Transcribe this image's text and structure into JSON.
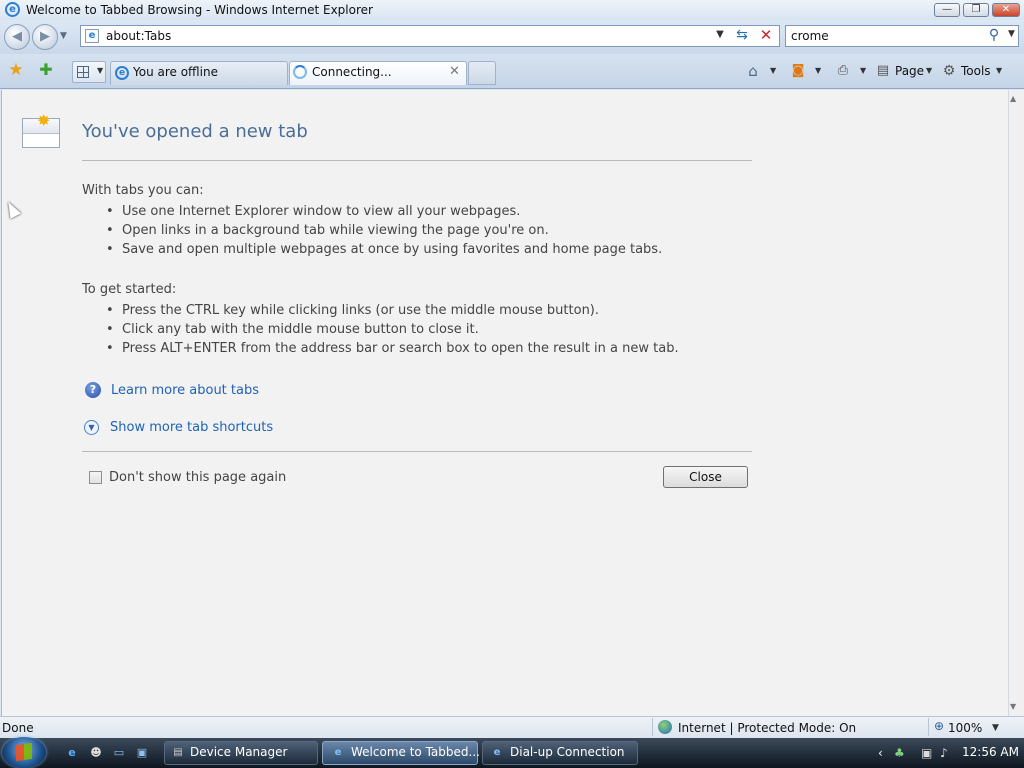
{
  "window": {
    "title": "Welcome to Tabbed Browsing - Windows Internet Explorer",
    "controls": {
      "minimize": "—",
      "maximize": "❐",
      "close": "✕"
    }
  },
  "address_bar": {
    "url": "about:Tabs",
    "back_icon": "back-arrow",
    "forward_icon": "forward-arrow"
  },
  "search": {
    "value": "crome"
  },
  "tabs": [
    {
      "label": "You are offline",
      "state": "inactive"
    },
    {
      "label": "Connecting...",
      "state": "active"
    }
  ],
  "command_bar": {
    "page_label": "Page",
    "tools_label": "Tools"
  },
  "content": {
    "heading": "You've opened a new tab",
    "section1_title": "With tabs you can:",
    "section1_items": [
      "Use one Internet Explorer window to view all your webpages.",
      "Open links in a background tab while viewing the page you're on.",
      "Save and open multiple webpages at once by using favorites and home page tabs."
    ],
    "section2_title": "To get started:",
    "section2_items": [
      "Press the CTRL key while clicking links (or use the middle mouse button).",
      "Click any tab with the middle mouse button to close it.",
      "Press ALT+ENTER from the address bar or search box to open the result in a new tab."
    ],
    "learn_more_link": "Learn more about tabs",
    "shortcuts_link": "Show more tab shortcuts",
    "checkbox_label": "Don't show this page again",
    "checkbox_checked": false,
    "close_button": "Close"
  },
  "status_bar": {
    "status": "Done",
    "zone": "Internet | Protected Mode: On",
    "zoom": "100%"
  },
  "taskbar": {
    "buttons": [
      {
        "label": "Device Manager",
        "active": false
      },
      {
        "label": "Welcome to Tabbed...",
        "active": true
      },
      {
        "label": "Dial-up Connection",
        "active": false
      }
    ],
    "clock": "12:56 AM"
  },
  "colors": {
    "heading": "#4a6e97",
    "link": "#1f62b5",
    "content_bg": "#f2f2f2",
    "taskbar": "#1c2a3a"
  }
}
